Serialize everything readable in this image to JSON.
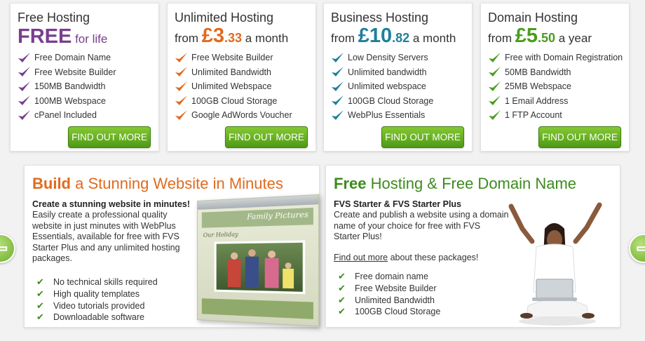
{
  "colors": {
    "purple": "#7a3d8f",
    "orange": "#e06a1f",
    "teal": "#1f7f9a",
    "green": "#4a9d1c",
    "build_orange": "#e06a1f",
    "free_green": "#3d8b1d"
  },
  "plans": [
    {
      "title": "Free Hosting",
      "price_prefix": "",
      "price_big": "FREE",
      "price_cents": "",
      "price_suffix": " for life",
      "tick_color": "#7a3d8f",
      "features": [
        "Free Domain Name",
        "Free Website Builder",
        "150MB Bandwidth",
        "100MB Webspace",
        "cPanel Included"
      ],
      "button": "FIND OUT MORE"
    },
    {
      "title": "Unlimited Hosting",
      "price_prefix": "from ",
      "price_big": "£3",
      "price_cents": ".33",
      "price_suffix": " a month",
      "tick_color": "#e06a1f",
      "features": [
        "Free Website Builder",
        "Unlimited Bandwidth",
        "Unlimited Webspace",
        "100GB Cloud Storage",
        "Google AdWords Voucher"
      ],
      "button": "FIND OUT MORE"
    },
    {
      "title": "Business Hosting",
      "price_prefix": "from ",
      "price_big": "£10",
      "price_cents": ".82",
      "price_suffix": " a month",
      "tick_color": "#1f7f9a",
      "features": [
        "Low Density Servers",
        "Unlimited bandwidth",
        "Unlimited webspace",
        "100GB Cloud Storage",
        "WebPlus Essentials"
      ],
      "button": "FIND OUT MORE"
    },
    {
      "title": "Domain Hosting",
      "price_prefix": "from ",
      "price_big": "£5",
      "price_cents": ".50",
      "price_suffix": " a year",
      "tick_color": "#4a9d1c",
      "features": [
        "Free with Domain Registration",
        "50MB Bandwidth",
        "25MB Webspace",
        "1 Email Address",
        "1 FTP Account"
      ],
      "button": "FIND OUT MORE"
    }
  ],
  "build": {
    "title_bold": "Build",
    "title_rest": " a Stunning Website in Minutes",
    "subtitle": "Create a stunning website in minutes!",
    "desc": "Easily create a professional quality website in just minutes with WebPlus Essentials, available for free with FVS Starter Plus and any unlimited hosting packages.",
    "features": [
      "No technical skills required",
      "High quality templates",
      "Video tutorials provided",
      "Downloadable software"
    ],
    "screenshot_title": "Family Pictures",
    "screenshot_caption": "Our Holiday"
  },
  "free": {
    "title_bold": "Free",
    "title_rest": " Hosting & Free Domain Name",
    "subtitle": "FVS Starter & FVS Starter Plus",
    "desc": "Create and publish a website using a domain name of your choice for free with FVS Starter Plus!",
    "link": "Find out more",
    "link_rest": " about these packages!",
    "features": [
      "Free domain name",
      "Free Website Builder",
      "Unlimited Bandwidth",
      "100GB Cloud Storage"
    ]
  },
  "arrows": {
    "prev": "⇦",
    "next": "⇨"
  }
}
